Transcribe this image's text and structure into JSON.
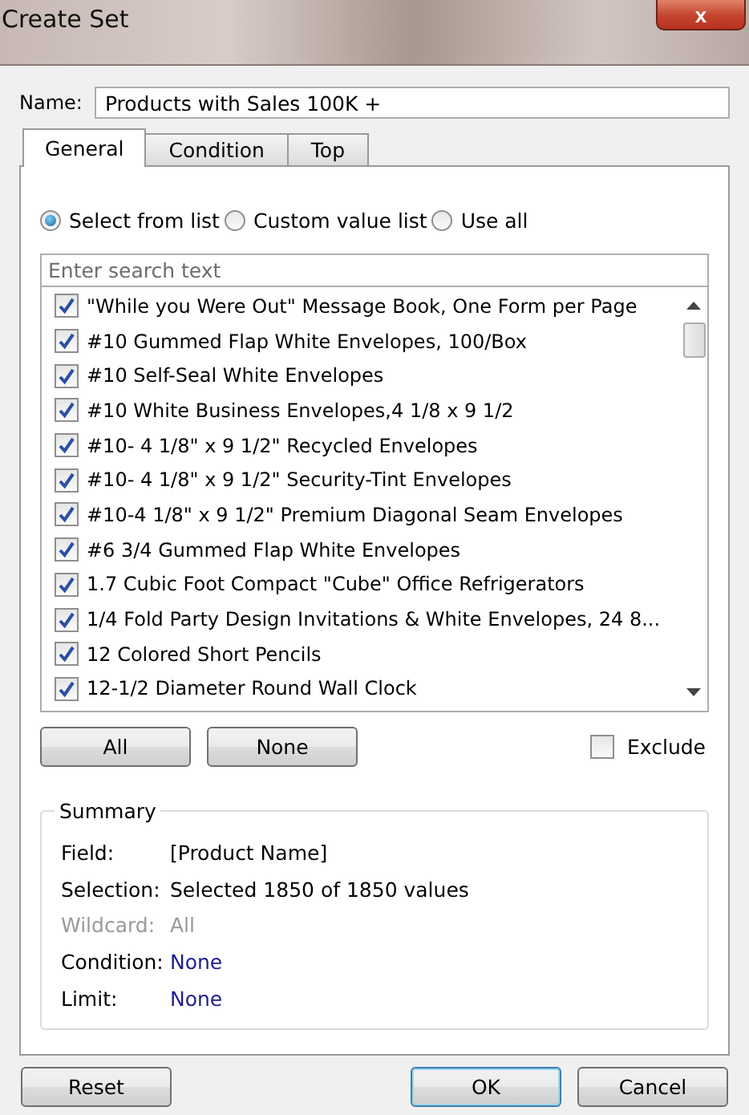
{
  "window": {
    "title": "Create Set",
    "close_label": "x"
  },
  "name_field": {
    "label": "Name:",
    "value": "Products with Sales 100K +"
  },
  "tabs": [
    {
      "label": "General",
      "selected": true
    },
    {
      "label": "Condition",
      "selected": false
    },
    {
      "label": "Top",
      "selected": false
    }
  ],
  "modes": [
    {
      "label": "Select from list",
      "selected": true
    },
    {
      "label": "Custom value list",
      "selected": false
    },
    {
      "label": "Use all",
      "selected": false
    }
  ],
  "search": {
    "placeholder": "Enter search text"
  },
  "items": [
    {
      "label": "\"While you Were Out\" Message Book, One Form per Page",
      "checked": true
    },
    {
      "label": "#10 Gummed Flap White Envelopes, 100/Box",
      "checked": true
    },
    {
      "label": "#10 Self-Seal White Envelopes",
      "checked": true
    },
    {
      "label": "#10 White Business Envelopes,4 1/8 x 9 1/2",
      "checked": true
    },
    {
      "label": "#10- 4 1/8\" x 9 1/2\" Recycled Envelopes",
      "checked": true
    },
    {
      "label": "#10- 4 1/8\" x 9 1/2\" Security-Tint Envelopes",
      "checked": true
    },
    {
      "label": "#10-4 1/8\" x 9 1/2\" Premium Diagonal Seam Envelopes",
      "checked": true
    },
    {
      "label": "#6 3/4 Gummed Flap White Envelopes",
      "checked": true
    },
    {
      "label": "1.7 Cubic Foot Compact \"Cube\" Office Refrigerators",
      "checked": true
    },
    {
      "label": "1/4 Fold Party Design Invitations & White Envelopes, 24 8...",
      "checked": true
    },
    {
      "label": "12 Colored Short Pencils",
      "checked": true
    },
    {
      "label": "12-1/2 Diameter Round Wall Clock",
      "checked": true
    }
  ],
  "list_buttons": [
    "All",
    "None"
  ],
  "exclude": {
    "label": "Exclude",
    "checked": false
  },
  "summary": {
    "title": "Summary",
    "rows": [
      {
        "label": "Field:",
        "value": "[Product Name]",
        "kind": "plain"
      },
      {
        "label": "Selection:",
        "value": "Selected 1850 of 1850 values",
        "kind": "plain"
      },
      {
        "label": "Wildcard:",
        "value": "All",
        "kind": "disabled"
      },
      {
        "label": "Condition:",
        "value": "None",
        "kind": "link"
      },
      {
        "label": "Limit:",
        "value": "None",
        "kind": "link"
      }
    ]
  },
  "footer": {
    "reset": "Reset",
    "ok": "OK",
    "cancel": "Cancel"
  }
}
